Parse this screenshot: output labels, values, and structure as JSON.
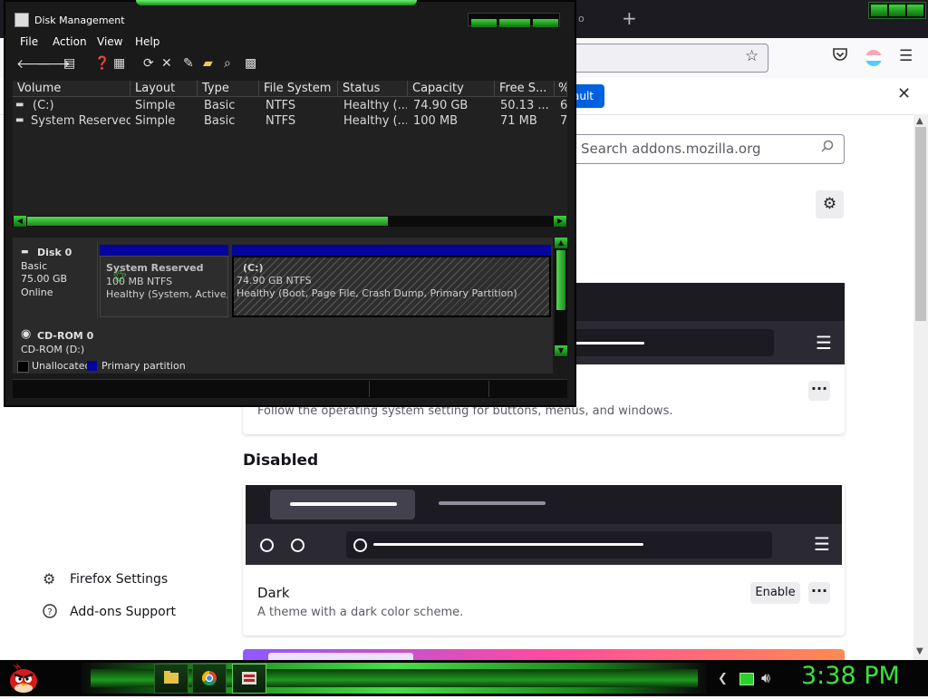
{
  "firefox": {
    "partial_tab_text": "o",
    "new_tab_symbol": "+",
    "url_value": "",
    "notification": {
      "button_label": "ault",
      "close_symbol": "✕"
    },
    "search": {
      "placeholder": "Search addons.mozilla.org"
    },
    "system_theme_card": {
      "description": "Follow the operating system setting for buttons, menus, and windows.",
      "more_label": "···"
    },
    "disabled_heading": "Disabled",
    "dark_theme_card": {
      "name": "Dark",
      "description": "A theme with a dark color scheme.",
      "enable_label": "Enable",
      "more_label": "···"
    },
    "sidebar_footer": [
      {
        "label": "Firefox Settings",
        "icon": "gear-icon"
      },
      {
        "label": "Add-ons Support",
        "icon": "help-icon"
      }
    ]
  },
  "disk_management": {
    "title": "Disk Management",
    "menu": [
      "File",
      "Action",
      "View",
      "Help"
    ],
    "columns": [
      "Volume",
      "Layout",
      "Type",
      "File System",
      "Status",
      "Capacity",
      "Free S...",
      "%"
    ],
    "volumes": [
      {
        "volume": "(C:)",
        "layout": "Simple",
        "type": "Basic",
        "fs": "NTFS",
        "status": "Healthy (...",
        "capacity": "74.90 GB",
        "free": "50.13 ...",
        "pct": "6"
      },
      {
        "volume": "System Reserved",
        "layout": "Simple",
        "type": "Basic",
        "fs": "NTFS",
        "status": "Healthy (...",
        "capacity": "100 MB",
        "free": "71 MB",
        "pct": "7"
      }
    ],
    "disk0": {
      "name": "Disk 0",
      "type": "Basic",
      "size": "75.00 GB",
      "state": "Online",
      "partitions": [
        {
          "name": "System Reserved",
          "size_fs": "100 MB NTFS",
          "status": "Healthy (System, Active, P"
        },
        {
          "name": "(C:)",
          "size_fs": "74.90 GB NTFS",
          "status": "Healthy (Boot, Page File, Crash Dump, Primary Partition)"
        }
      ]
    },
    "cdrom0": {
      "name": "CD-ROM 0",
      "drive": "CD-ROM (D:)"
    },
    "legend": [
      {
        "label": "Unallocated",
        "color": "#000000"
      },
      {
        "label": "Primary partition",
        "color": "#05059e"
      }
    ]
  },
  "taskbar": {
    "clock": "3:38 PM",
    "accent_color": "#3be33b"
  }
}
